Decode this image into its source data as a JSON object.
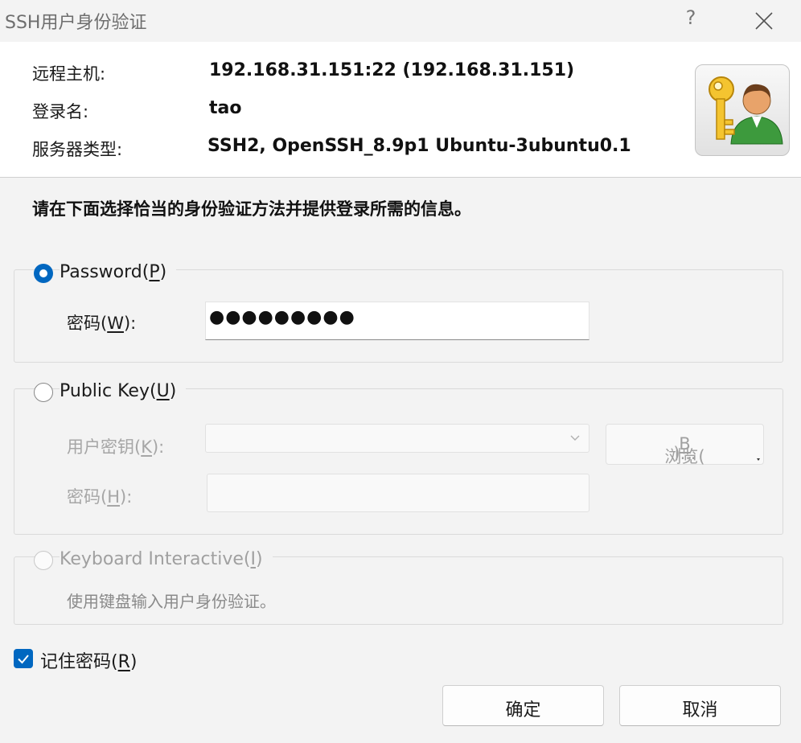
{
  "window": {
    "title": "SSH用户身份验证"
  },
  "header": {
    "remote_host_label": "远程主机:",
    "remote_host_value": "192.168.31.151:22 (192.168.31.151)",
    "login_label": "登录名:",
    "login_value": "tao",
    "server_type_label": "服务器类型:",
    "server_type_value": "SSH2, OpenSSH_8.9p1 Ubuntu-3ubuntu0.1",
    "icon": "key-user-icon"
  },
  "instruction": "请在下面选择恰当的身份验证方法并提供登录所需的信息。",
  "password_method": {
    "label_prefix": "Password(",
    "label_key": "P",
    "label_suffix": ")",
    "selected": true,
    "field_label_prefix": "密码(",
    "field_label_key": "W",
    "field_label_suffix": "):",
    "value": "●●●●●●●●●"
  },
  "publickey_method": {
    "label_prefix": "Public Key(",
    "label_key": "U",
    "label_suffix": ")",
    "selected": false,
    "key_label_prefix": "用户密钥(",
    "key_label_key": "K",
    "key_label_suffix": "):",
    "key_value": "",
    "browse_prefix": "浏览(",
    "browse_key": "B",
    "browse_suffix": ")...",
    "pass_label_prefix": "密码(",
    "pass_label_key": "H",
    "pass_label_suffix": "):",
    "pass_value": ""
  },
  "keyboard_method": {
    "label_prefix": "Keyboard Interactive(",
    "label_key": "I",
    "label_suffix": ")",
    "enabled": false,
    "hint": "使用键盘输入用户身份验证。"
  },
  "remember": {
    "label_prefix": "记住密码(",
    "label_key": "R",
    "label_suffix": ")",
    "checked": true
  },
  "buttons": {
    "ok": "确定",
    "cancel": "取消"
  },
  "colors": {
    "accent": "#0067c0",
    "background": "#f3f3f3"
  }
}
